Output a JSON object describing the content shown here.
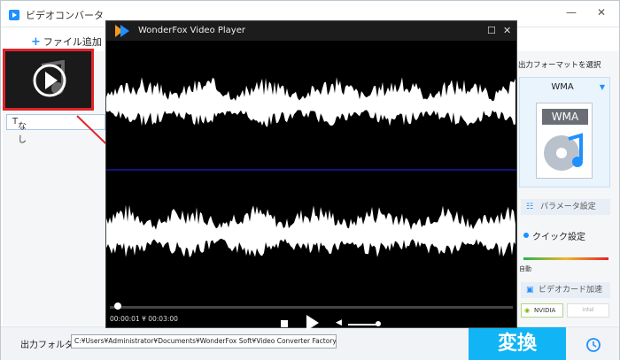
{
  "app": {
    "title": "ビデオコンバータ",
    "minimize": "—",
    "close": "✕"
  },
  "toolbar": {
    "add_file_label": "ファイル追加"
  },
  "left": {
    "subtitle_value": "なし"
  },
  "player": {
    "title": "WonderFox Video Player",
    "maximize": "☐",
    "close": "✕",
    "time_text": "00:00:01 ¥ 00:03:00",
    "progress_fraction": 0.01
  },
  "right": {
    "format_title": "出力フォーマットを選択",
    "format_name": "WMA",
    "format_icon_label": "WMA",
    "param_label": "パラメータ設定",
    "quick_label": "クイック設定",
    "auto_label": "自動",
    "gpu_label": "ビデオカード加速",
    "nvidia_label": "NVIDIA",
    "intel_label": "intel"
  },
  "bottom": {
    "output_label": "出力フォルダ：",
    "output_path": "C:¥Users¥Administrator¥Documents¥WonderFox Soft¥Video Converter Factory¥OutputVideo¥",
    "convert_label": "変換"
  },
  "colors": {
    "accent": "#11b5f5",
    "highlight": "#e0242a",
    "divider": "#1a1aa0"
  }
}
